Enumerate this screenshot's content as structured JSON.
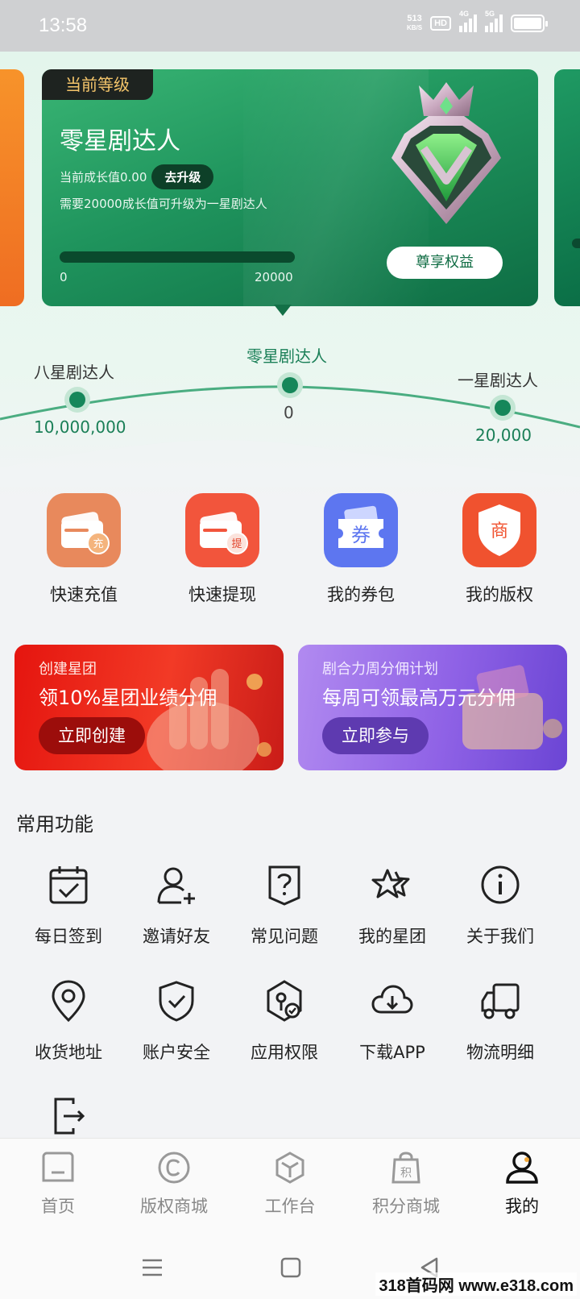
{
  "status_bar": {
    "time": "13:58",
    "net_speed_value": "513",
    "net_speed_unit": "KB/S",
    "hd_label": "HD",
    "signal1_label": "4G",
    "signal2_label": "5G"
  },
  "level_card": {
    "tag": "当前等级",
    "level_name": "零星剧达人",
    "growth_text": "当前成长值0.00",
    "upgrade_label": "去升级",
    "need_text": "需要20000成长值可升级为一星剧达人",
    "progress_fraction": 0.0,
    "progress_min": "0",
    "progress_max": "20000",
    "benefit_label": "尊享权益"
  },
  "level_track": {
    "left": {
      "name": "八星剧达人",
      "value": "10,000,000"
    },
    "current": {
      "name": "零星剧达人",
      "value": "0"
    },
    "right": {
      "name": "一星剧达人",
      "value": "20,000"
    }
  },
  "quick_actions": [
    {
      "label": "快速充值",
      "icon": "wallet-recharge-icon",
      "color": "#e8895c",
      "glyph": "充"
    },
    {
      "label": "快速提现",
      "icon": "wallet-withdraw-icon",
      "color": "#f2553c",
      "glyph": "提"
    },
    {
      "label": "我的券包",
      "icon": "coupon-icon",
      "color": "#5d76f0",
      "glyph": "券"
    },
    {
      "label": "我的版权",
      "icon": "copyright-shield-icon",
      "color": "#f0522f",
      "glyph": "商"
    }
  ],
  "promos": {
    "red": {
      "sub": "创建星团",
      "title": "领10%星团业绩分佣",
      "button": "立即创建"
    },
    "purple": {
      "sub": "剧合力周分佣计划",
      "title": "每周可领最高万元分佣",
      "button": "立即参与"
    }
  },
  "common": {
    "title": "常用功能",
    "items": [
      {
        "label": "每日签到",
        "icon": "calendar-check-icon"
      },
      {
        "label": "邀请好友",
        "icon": "add-user-icon"
      },
      {
        "label": "常见问题",
        "icon": "question-icon"
      },
      {
        "label": "我的星团",
        "icon": "stars-icon"
      },
      {
        "label": "关于我们",
        "icon": "info-icon"
      },
      {
        "label": "收货地址",
        "icon": "location-icon"
      },
      {
        "label": "账户安全",
        "icon": "shield-check-icon"
      },
      {
        "label": "应用权限",
        "icon": "permission-icon"
      },
      {
        "label": "下载APP",
        "icon": "cloud-download-icon"
      },
      {
        "label": "物流明细",
        "icon": "truck-icon"
      },
      {
        "label": "",
        "icon": "logout-icon"
      }
    ]
  },
  "tabs": [
    {
      "label": "首页",
      "icon": "home-icon",
      "active": false
    },
    {
      "label": "版权商城",
      "icon": "copyright-icon",
      "active": false
    },
    {
      "label": "工作台",
      "icon": "workbench-icon",
      "active": false
    },
    {
      "label": "积分商城",
      "icon": "points-bag-icon",
      "active": false,
      "glyph": "积"
    },
    {
      "label": "我的",
      "icon": "user-icon",
      "active": true
    }
  ],
  "nav": [
    "menu-icon",
    "home-square-icon",
    "back-icon"
  ],
  "watermark": "318首码网 www.e318.com"
}
